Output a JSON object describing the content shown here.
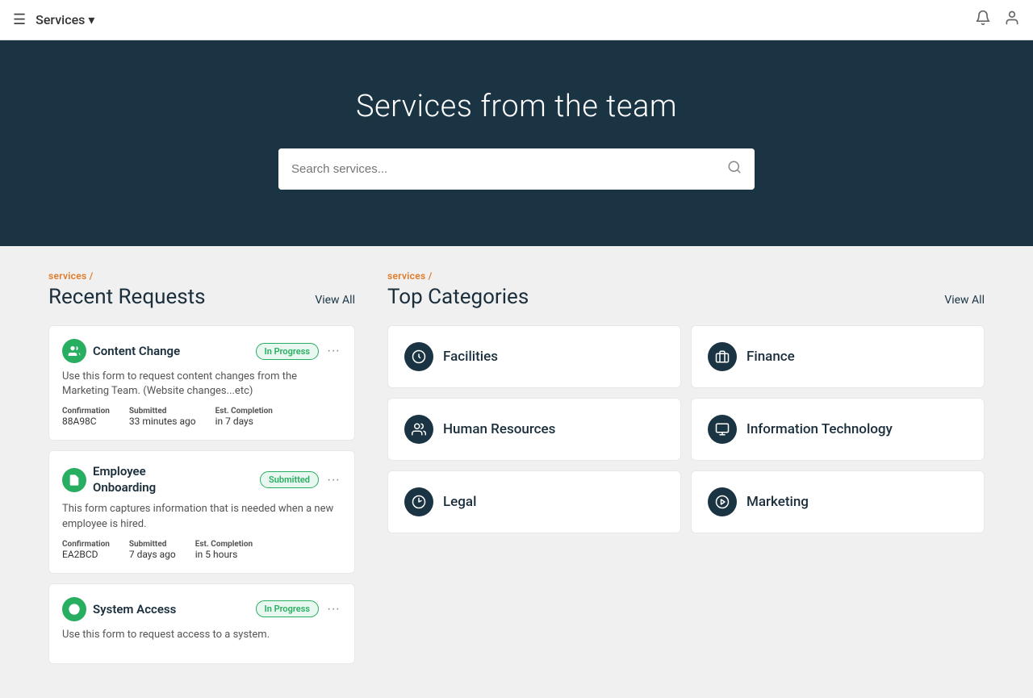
{
  "topnav": {
    "brand": "Services ▾",
    "hamburger": "☰",
    "bell": "🔔",
    "user": "👤"
  },
  "hero": {
    "title": "Services from the team",
    "search_placeholder": "Search services..."
  },
  "recent_requests": {
    "breadcrumb": "services /",
    "title": "Recent Requests",
    "view_all": "View All",
    "cards": [
      {
        "icon": "👥",
        "title": "Content Change",
        "status": "In Progress",
        "status_type": "in-progress",
        "description": "Use this form to request content changes from the Marketing Team. (Website changes...etc)",
        "confirmation_label": "Confirmation",
        "confirmation_value": "88A98C",
        "submitted_label": "Submitted",
        "submitted_value": "33 minutes ago",
        "est_label": "Est. Completion",
        "est_value": "in 7 days"
      },
      {
        "icon": "📄",
        "title": "Employee\nOnboarding",
        "status": "Submitted",
        "status_type": "submitted",
        "description": "This form captures information that is needed when a new employee is hired.",
        "confirmation_label": "Confirmation",
        "confirmation_value": "EA2BCD",
        "submitted_label": "Submitted",
        "submitted_value": "7 days ago",
        "est_label": "Est. Completion",
        "est_value": "in 5 hours"
      },
      {
        "icon": "⚙",
        "title": "System Access",
        "status": "In Progress",
        "status_type": "in-progress",
        "description": "Use this form to request access to a system.",
        "confirmation_label": "",
        "confirmation_value": "",
        "submitted_label": "",
        "submitted_value": "",
        "est_label": "",
        "est_value": ""
      }
    ]
  },
  "top_categories": {
    "breadcrumb": "services /",
    "title": "Top Categories",
    "view_all": "View All",
    "categories": [
      {
        "name": "Facilities",
        "icon": "➡",
        "icon_bg": "#1a3444"
      },
      {
        "name": "Finance",
        "icon": "💰",
        "icon_bg": "#1a3444"
      },
      {
        "name": "Human Resources",
        "icon": "👤",
        "icon_bg": "#1a3444"
      },
      {
        "name": "Information Technology",
        "icon": "🖥",
        "icon_bg": "#1a3444"
      },
      {
        "name": "Legal",
        "icon": "🔧",
        "icon_bg": "#1a3444"
      },
      {
        "name": "Marketing",
        "icon": "🎬",
        "icon_bg": "#1a3444"
      }
    ]
  }
}
